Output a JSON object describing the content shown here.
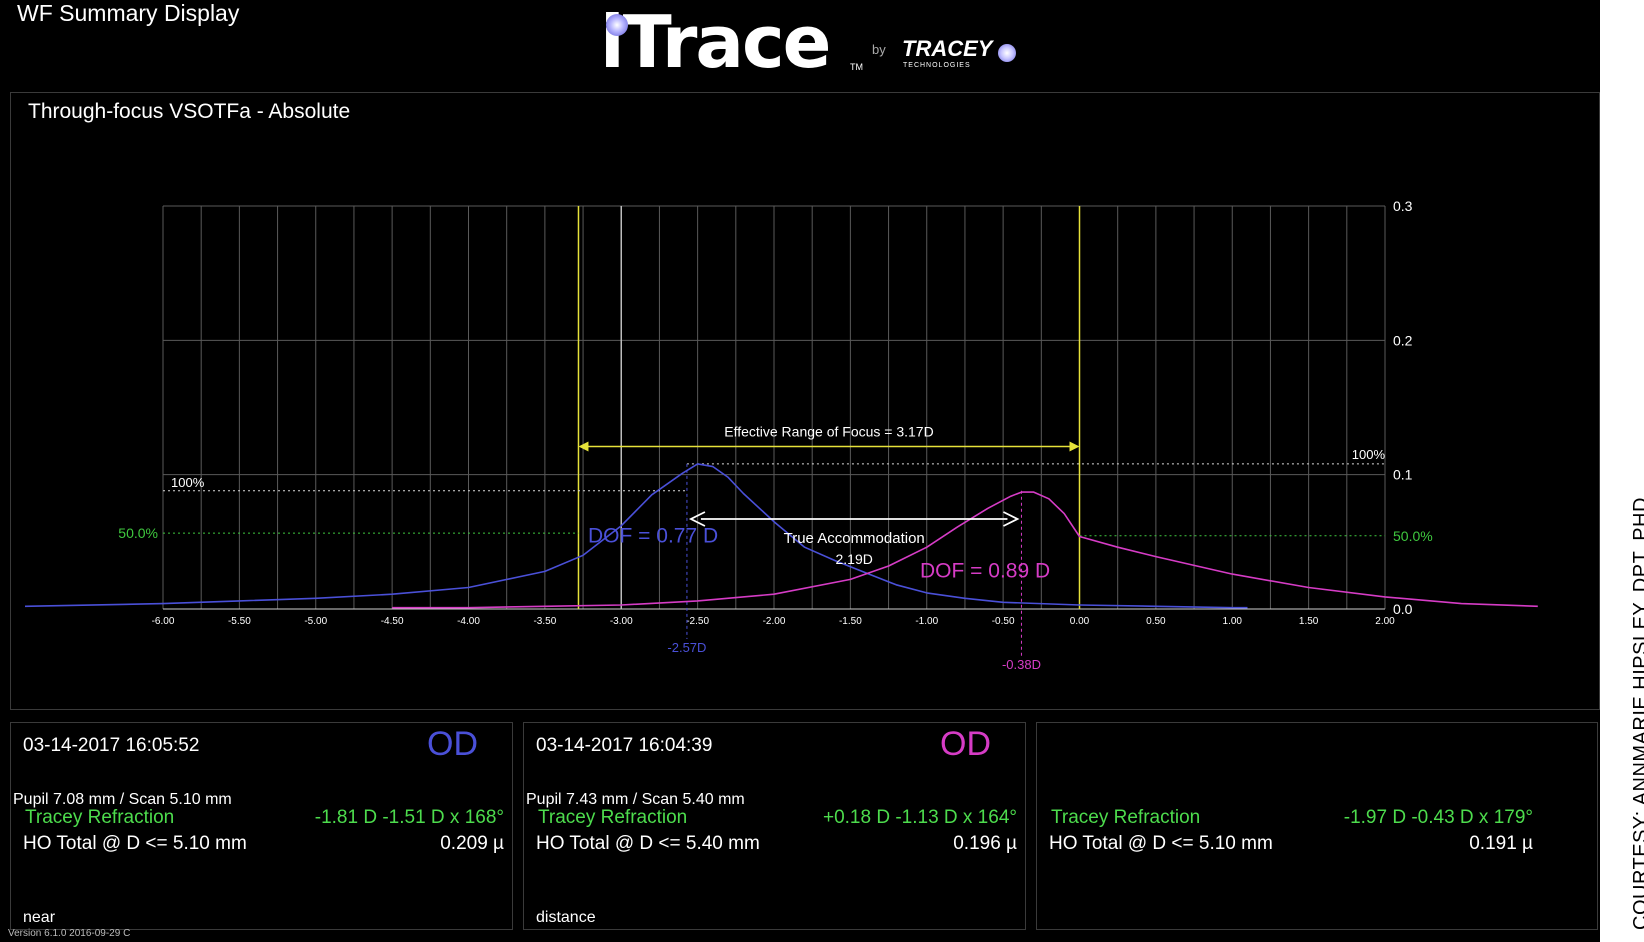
{
  "app_title": "WF Summary Display",
  "logo": {
    "main": "iTrace",
    "tm": "TM",
    "by": "by",
    "brand": "TRACEY",
    "sub": "TECHNOLOGIES"
  },
  "chart_panel_title": "Through-focus VSOTFa  - Absolute",
  "chart_data": {
    "type": "line",
    "title": "",
    "xlabel": "",
    "ylabel": "",
    "x_ticks": [
      "-6.00",
      "-5.50",
      "-5.00",
      "-4.50",
      "-4.00",
      "-3.50",
      "-3.00",
      "-2.50",
      "-2.00",
      "-1.50",
      "-1.00",
      "-0.50",
      "0.00",
      "0.50",
      "1.00",
      "1.50",
      "2.00"
    ],
    "y_ticks": [
      "0.0",
      "0.1",
      "0.2",
      "0.3"
    ],
    "xlim": [
      -6.0,
      2.0
    ],
    "ylim": [
      0,
      0.3
    ],
    "grid": true,
    "series": [
      {
        "color": "#4a50d8",
        "x": [
          -7.0,
          -6.0,
          -5.5,
          -5.0,
          -4.5,
          -4.0,
          -3.5,
          -3.25,
          -3.0,
          -2.8,
          -2.6,
          -2.5,
          -2.4,
          -2.3,
          -2.2,
          -2.0,
          -1.8,
          -1.6,
          -1.4,
          -1.2,
          -1.0,
          -0.75,
          -0.5,
          0.0,
          0.5,
          1.0,
          1.1
        ],
        "y": [
          0.002,
          0.004,
          0.006,
          0.008,
          0.011,
          0.016,
          0.028,
          0.04,
          0.062,
          0.085,
          0.101,
          0.108,
          0.106,
          0.098,
          0.086,
          0.065,
          0.046,
          0.036,
          0.027,
          0.018,
          0.012,
          0.008,
          0.005,
          0.003,
          0.002,
          0.001,
          0.001
        ]
      },
      {
        "color": "#d63cc6",
        "x": [
          -4.5,
          -4.0,
          -3.5,
          -3.0,
          -2.5,
          -2.0,
          -1.5,
          -1.25,
          -1.0,
          -0.8,
          -0.6,
          -0.45,
          -0.38,
          -0.3,
          -0.2,
          -0.1,
          0.0,
          0.25,
          0.5,
          1.0,
          1.5,
          2.0,
          2.5,
          3.0
        ],
        "y": [
          0.001,
          0.001,
          0.002,
          0.003,
          0.006,
          0.011,
          0.022,
          0.032,
          0.046,
          0.061,
          0.075,
          0.084,
          0.087,
          0.087,
          0.082,
          0.071,
          0.054,
          0.046,
          0.039,
          0.026,
          0.016,
          0.009,
          0.004,
          0.002
        ]
      }
    ],
    "annotations": {
      "near_peak_x": -2.57,
      "distance_peak_x": -0.38,
      "range_start_x": -3.28,
      "range_end_x": 0.0,
      "near_100_y": 0.088,
      "distance_100_y": 0.108,
      "near_50_y": 0.0565,
      "distance_50_y": 0.0545,
      "accommodation_y": 0.067,
      "range_arrow_y": 0.121,
      "effective_range_label": "Effective Range of Focus = 3.17D",
      "true_accommodation_label": "True Accommodation",
      "true_accommodation_value": "2.19D",
      "dof_near": "DOF = 0.77 D",
      "dof_distance": "DOF = 0.89 D",
      "pct100_left": "100%",
      "pct100_right": "100%",
      "pct50_left": "50.0%",
      "pct50_right": "50.0%",
      "near_peak_label": "-2.57D",
      "distance_peak_label": "-0.38D"
    }
  },
  "panels": [
    {
      "date": "03-14-2017  16:05:52",
      "eye": "OD",
      "eye_color": "#4a50d8",
      "pupil": "Pupil 7.08 mm  /  Scan 5.10 mm",
      "refraction_label": "Tracey Refraction",
      "refraction_value": "-1.81 D -1.51 D x 168°",
      "ho_label": "HO Total @ D <= 5.10 mm",
      "ho_value": "0.209 µ",
      "tag": "near"
    },
    {
      "date": "03-14-2017  16:04:39",
      "eye": "OD",
      "eye_color": "#d63cc6",
      "pupil": "Pupil 7.43 mm  /  Scan 5.40 mm",
      "refraction_label": "Tracey Refraction",
      "refraction_value": "+0.18 D -1.13 D x 164°",
      "ho_label": "HO Total @ D <= 5.40 mm",
      "ho_value": "0.196 µ",
      "tag": "distance"
    },
    {
      "refraction_label": "Tracey Refraction",
      "refraction_value": "-1.97 D -0.43 D x 179°",
      "ho_label": "HO Total @ D <= 5.10 mm",
      "ho_value": "0.191 µ"
    }
  ],
  "version": "Version 6.1.0 2016-09-29 C",
  "courtesy": "COURTESY: ANNMARIE HIPSLEY, DPT, PHD"
}
